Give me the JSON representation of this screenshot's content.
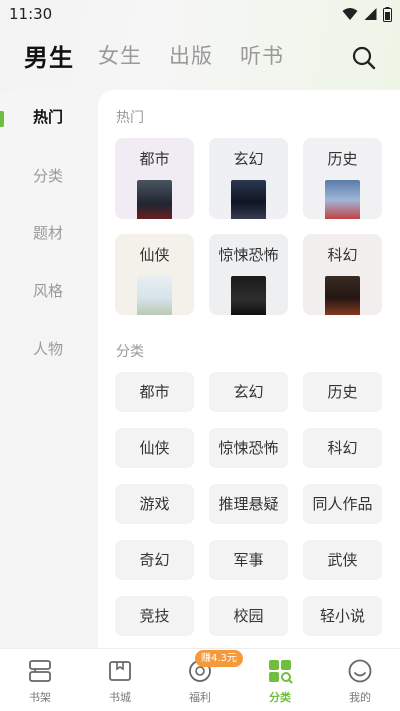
{
  "status": {
    "time": "11:30"
  },
  "header": {
    "tabs": [
      {
        "label": "男生",
        "active": true
      },
      {
        "label": "女生",
        "active": false
      },
      {
        "label": "出版",
        "active": false
      },
      {
        "label": "听书",
        "active": false
      }
    ]
  },
  "sidebar": {
    "items": [
      {
        "label": "热门",
        "active": true
      },
      {
        "label": "分类",
        "active": false
      },
      {
        "label": "题材",
        "active": false
      },
      {
        "label": "风格",
        "active": false
      },
      {
        "label": "人物",
        "active": false
      }
    ]
  },
  "hot": {
    "title": "热门",
    "cards": [
      {
        "label": "都市",
        "bg": "#f1ecf3"
      },
      {
        "label": "玄幻",
        "bg": "#eef0f4"
      },
      {
        "label": "历史",
        "bg": "#f1f1f3"
      },
      {
        "label": "仙侠",
        "bg": "#f3f1ea"
      },
      {
        "label": "惊悚恐怖",
        "bg": "#eeeff1"
      },
      {
        "label": "科幻",
        "bg": "#f3eeee"
      }
    ]
  },
  "categories": {
    "title": "分类",
    "items": [
      "都市",
      "玄幻",
      "历史",
      "仙侠",
      "惊悚恐怖",
      "科幻",
      "游戏",
      "推理悬疑",
      "同人作品",
      "奇幻",
      "军事",
      "武侠",
      "竞技",
      "校园",
      "轻小说"
    ]
  },
  "nav": {
    "items": [
      {
        "label": "书架",
        "icon": "bookshelf-icon",
        "active": false
      },
      {
        "label": "书城",
        "icon": "bookstore-icon",
        "active": false
      },
      {
        "label": "福利",
        "icon": "welfare-icon",
        "active": false
      },
      {
        "label": "分类",
        "icon": "category-icon",
        "active": true
      },
      {
        "label": "我的",
        "icon": "profile-icon",
        "active": false
      }
    ],
    "badge": "赚4.3元"
  },
  "colors": {
    "accent": "#6fbe3f",
    "badge": "#f59a3a"
  }
}
